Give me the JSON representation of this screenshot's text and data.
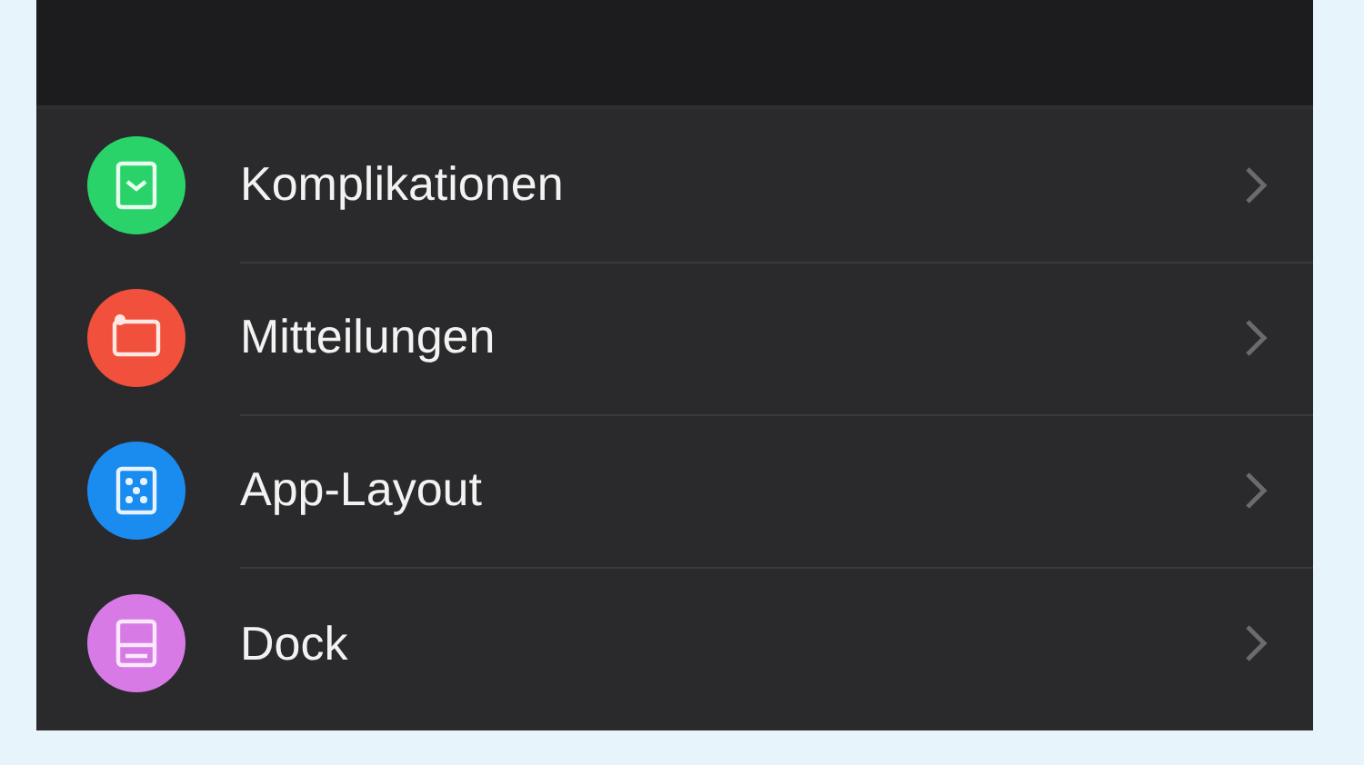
{
  "settings_list": {
    "items": [
      {
        "label": "Komplikationen",
        "color": "#2ad36a"
      },
      {
        "label": "Mitteilungen",
        "color": "#f0503c"
      },
      {
        "label": "App-Layout",
        "color": "#1a8cf0"
      },
      {
        "label": "Dock",
        "color": "#d77ae6"
      }
    ]
  }
}
